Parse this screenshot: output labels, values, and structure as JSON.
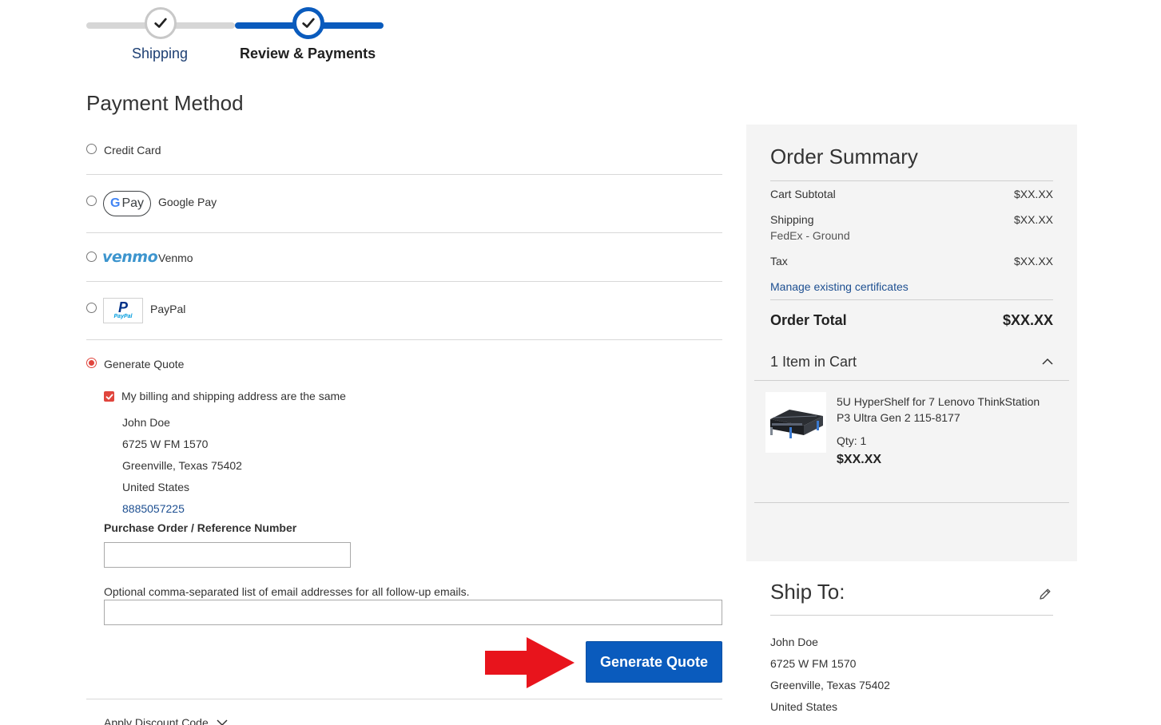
{
  "progress": {
    "steps": [
      {
        "label": "Shipping",
        "state": "complete"
      },
      {
        "label": "Review & Payments",
        "state": "current"
      }
    ]
  },
  "payment": {
    "title": "Payment Method",
    "options": [
      {
        "label": "Credit Card",
        "selected": false
      },
      {
        "label": "Google Pay",
        "selected": false,
        "logo_text": "Pay"
      },
      {
        "label": "Venmo",
        "selected": false,
        "logo_text": "venmo"
      },
      {
        "label": "PayPal",
        "selected": false,
        "logo_text": "PayPal"
      },
      {
        "label": "Generate Quote",
        "selected": true
      }
    ],
    "billing_same_label": "My billing and shipping address are the same",
    "billing_same_checked": true,
    "address": {
      "name": "John Doe",
      "street": "6725 W FM 1570",
      "city": "Greenville, Texas 75402",
      "country": "United States",
      "phone": "8885057225"
    },
    "po_label": "Purchase Order / Reference Number",
    "po_value": "",
    "emails_label": "Optional comma-separated list of email addresses for all follow-up emails.",
    "emails_value": "",
    "submit_label": "Generate Quote",
    "discount_label": "Apply Discount Code"
  },
  "summary": {
    "title": "Order Summary",
    "rows": {
      "subtotal_label": "Cart Subtotal",
      "subtotal_value": "$XX.XX",
      "shipping_label": "Shipping",
      "shipping_value": "$XX.XX",
      "shipping_method": "FedEx - Ground",
      "tax_label": "Tax",
      "tax_value": "$XX.XX"
    },
    "certificates_link": "Manage existing certificates",
    "total_label": "Order Total",
    "total_value": "$XX.XX",
    "cart_toggle_label": "1 Item in Cart",
    "item": {
      "name": "5U HyperShelf for 7 Lenovo ThinkStation P3 Ultra Gen 2 115-8177",
      "qty": "Qty: 1",
      "price": "$XX.XX"
    }
  },
  "ship_to": {
    "title": "Ship To:",
    "name": "John Doe",
    "street": "6725 W FM 1570",
    "city": "Greenville, Texas 75402",
    "country": "United States"
  },
  "colors": {
    "brand_blue": "#0a5bbd",
    "accent_red": "#e0453d",
    "arrow_red": "#e8141c"
  }
}
